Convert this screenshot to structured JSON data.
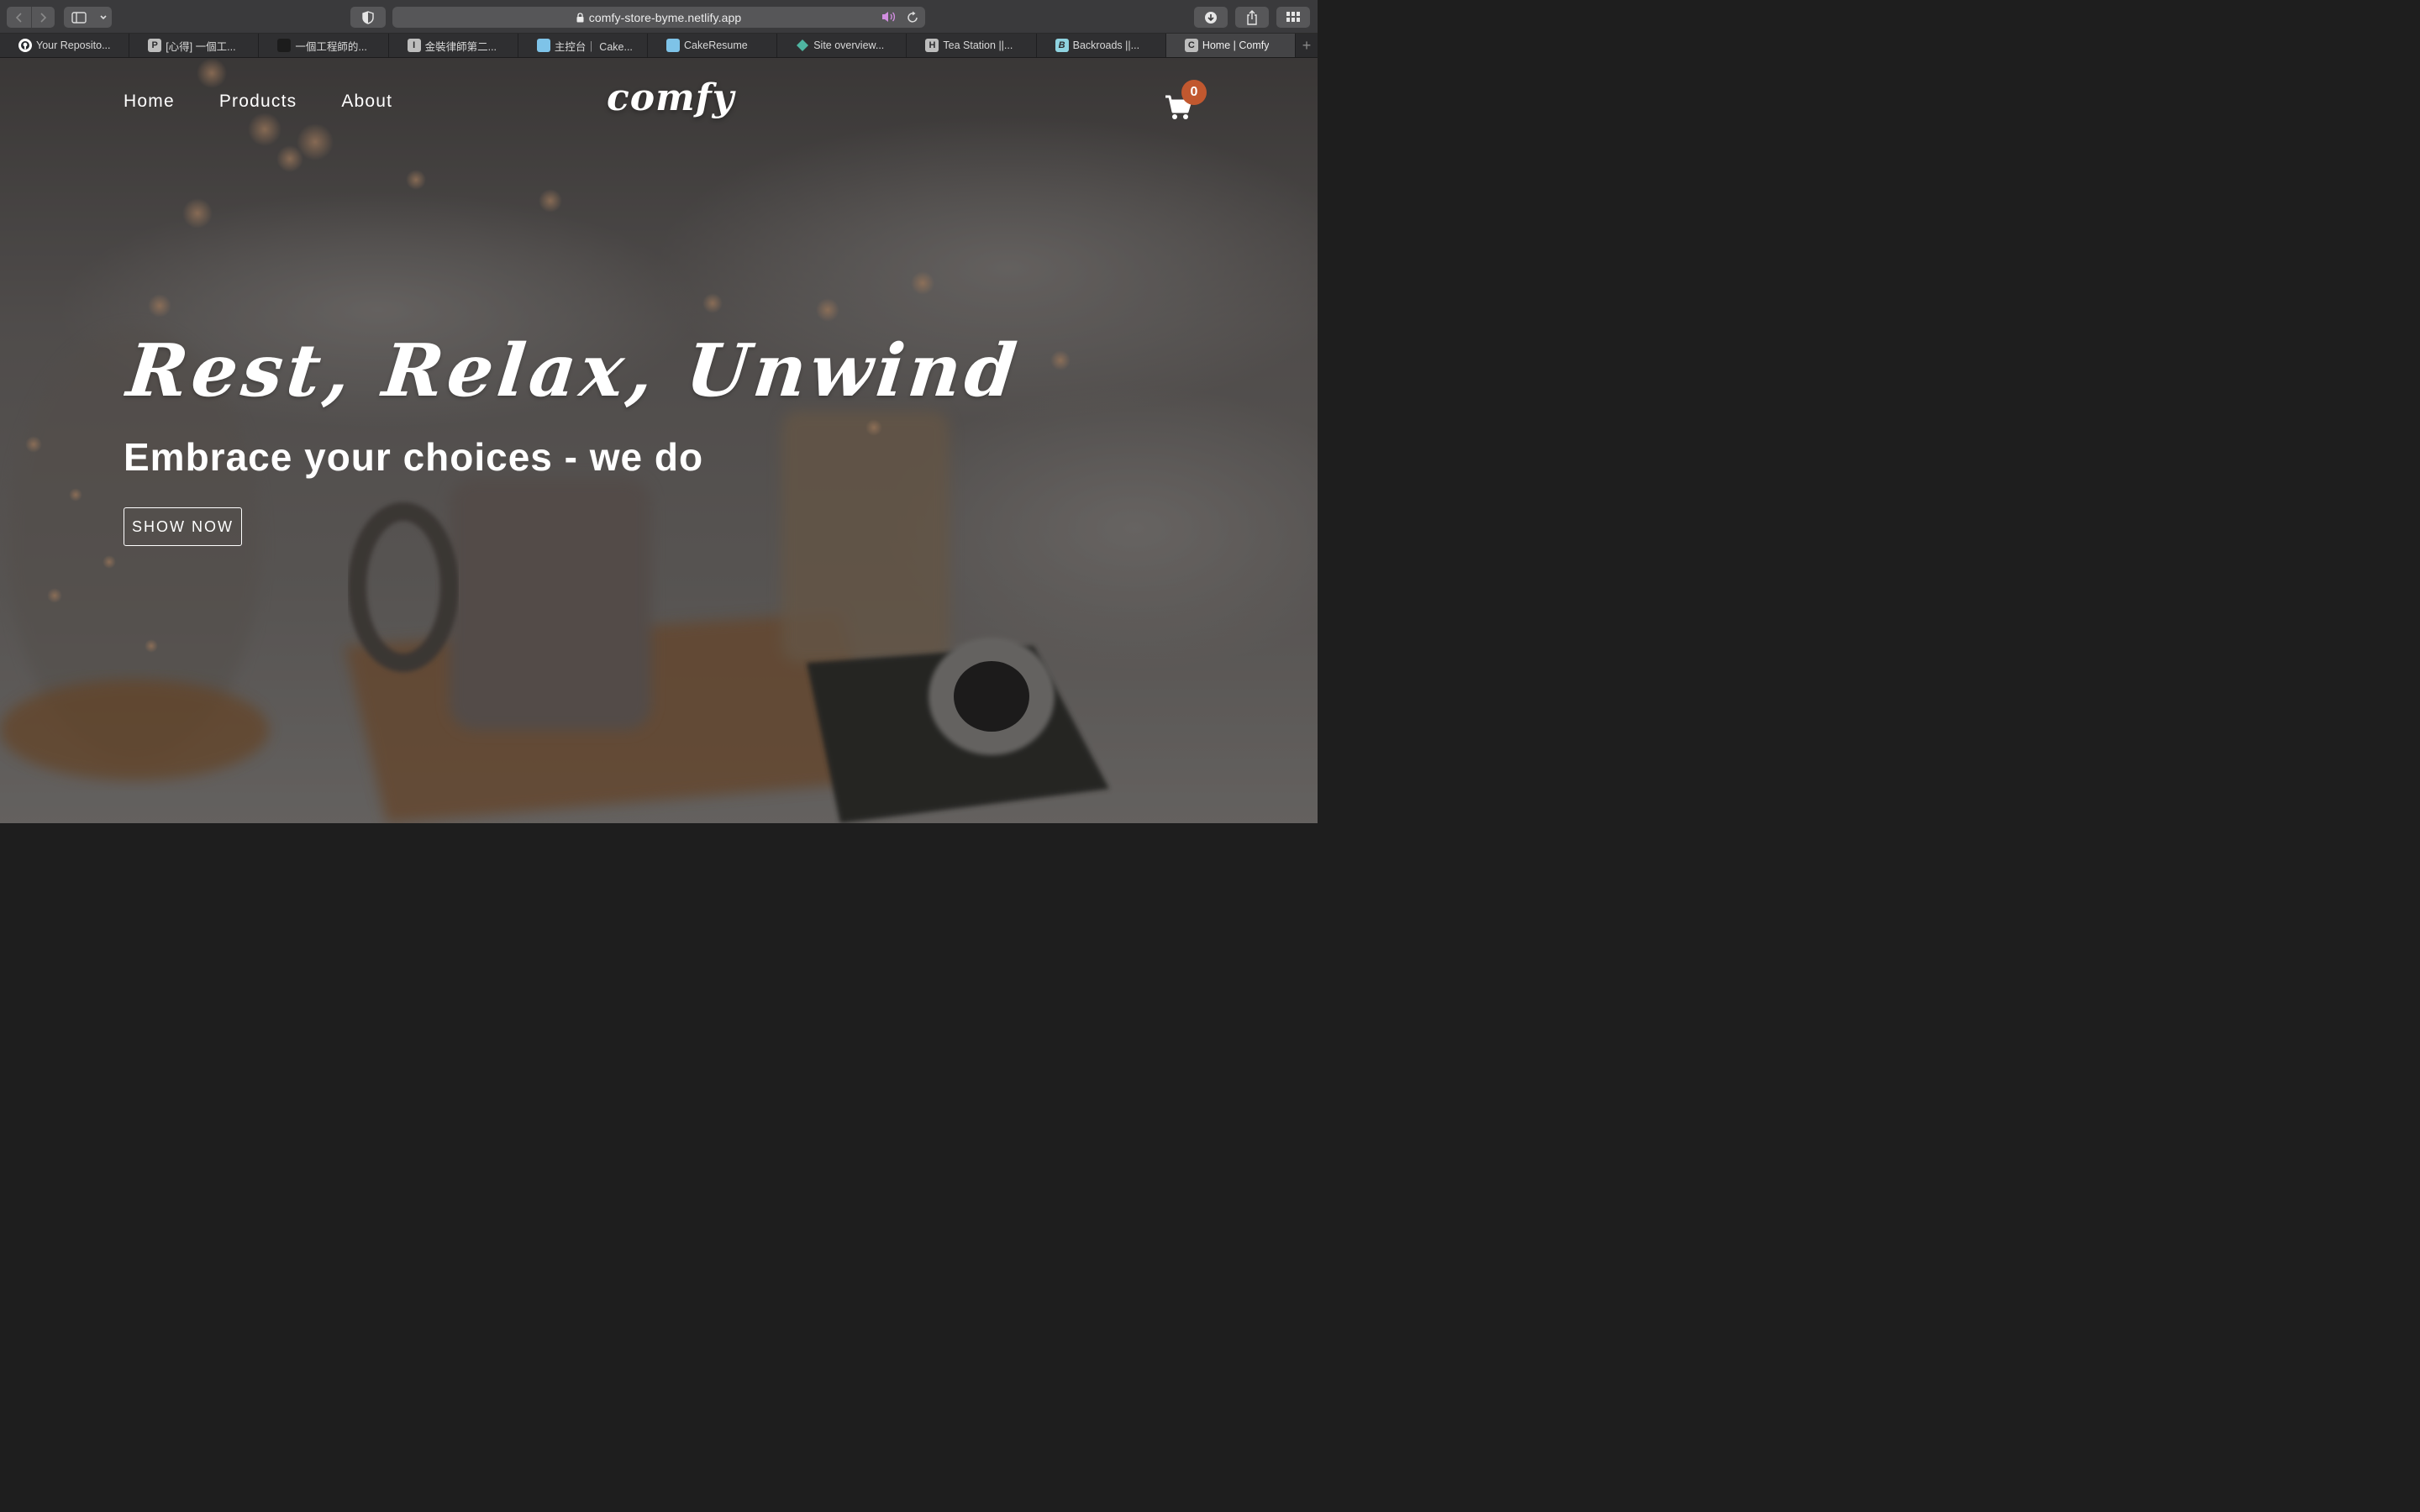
{
  "browser": {
    "url": "comfy-store-byme.netlify.app",
    "tabs": [
      {
        "label": "Your Reposito...",
        "favicon_letter": "",
        "favicon_color": "#ffffff",
        "icon": "github-icon",
        "active": false
      },
      {
        "label": "[心得] 一個工...",
        "favicon_letter": "P",
        "favicon_color": "#bdbdbd",
        "icon": "letter-p-icon",
        "active": false
      },
      {
        "label": "一個工程師的...",
        "favicon_letter": "",
        "favicon_color": "#1c1c1c",
        "icon": "dark-square-icon",
        "active": false
      },
      {
        "label": "金裝律師第二...",
        "favicon_letter": "I",
        "favicon_color": "#bdbdbd",
        "icon": "letter-i-icon",
        "active": false
      },
      {
        "label": "主控台｜ Cake...",
        "favicon_letter": "",
        "favicon_color": "#7ec3e8",
        "icon": "cakeresume-icon",
        "active": false
      },
      {
        "label": "CakeResume",
        "favicon_letter": "",
        "favicon_color": "#7ec3e8",
        "icon": "cakeresume-icon",
        "active": false
      },
      {
        "label": "Site overview...",
        "favicon_letter": "",
        "favicon_color": "#4fb5a2",
        "icon": "netlify-diamond-icon",
        "active": false
      },
      {
        "label": "Tea Station ||...",
        "favicon_letter": "H",
        "favicon_color": "#bdbdbd",
        "icon": "letter-h-icon",
        "active": false
      },
      {
        "label": "Backroads ||...",
        "favicon_letter": "B",
        "favicon_color": "#8fd3e0",
        "icon": "letter-b-icon",
        "active": false
      },
      {
        "label": "Home | Comfy",
        "favicon_letter": "C",
        "favicon_color": "#bdbdbd",
        "icon": "letter-c-icon",
        "active": true
      }
    ],
    "new_tab_symbol": "+"
  },
  "site": {
    "nav": {
      "home": "Home",
      "products": "Products",
      "about": "About"
    },
    "logo": "comfy",
    "cart_count": "0",
    "hero": {
      "title": "Rest, Relax, Unwind",
      "subtitle": "Embrace your choices - we do",
      "button": "SHOW NOW"
    }
  },
  "colors": {
    "badge": "#c1582f",
    "speaker_icon": "#d18ee0"
  }
}
